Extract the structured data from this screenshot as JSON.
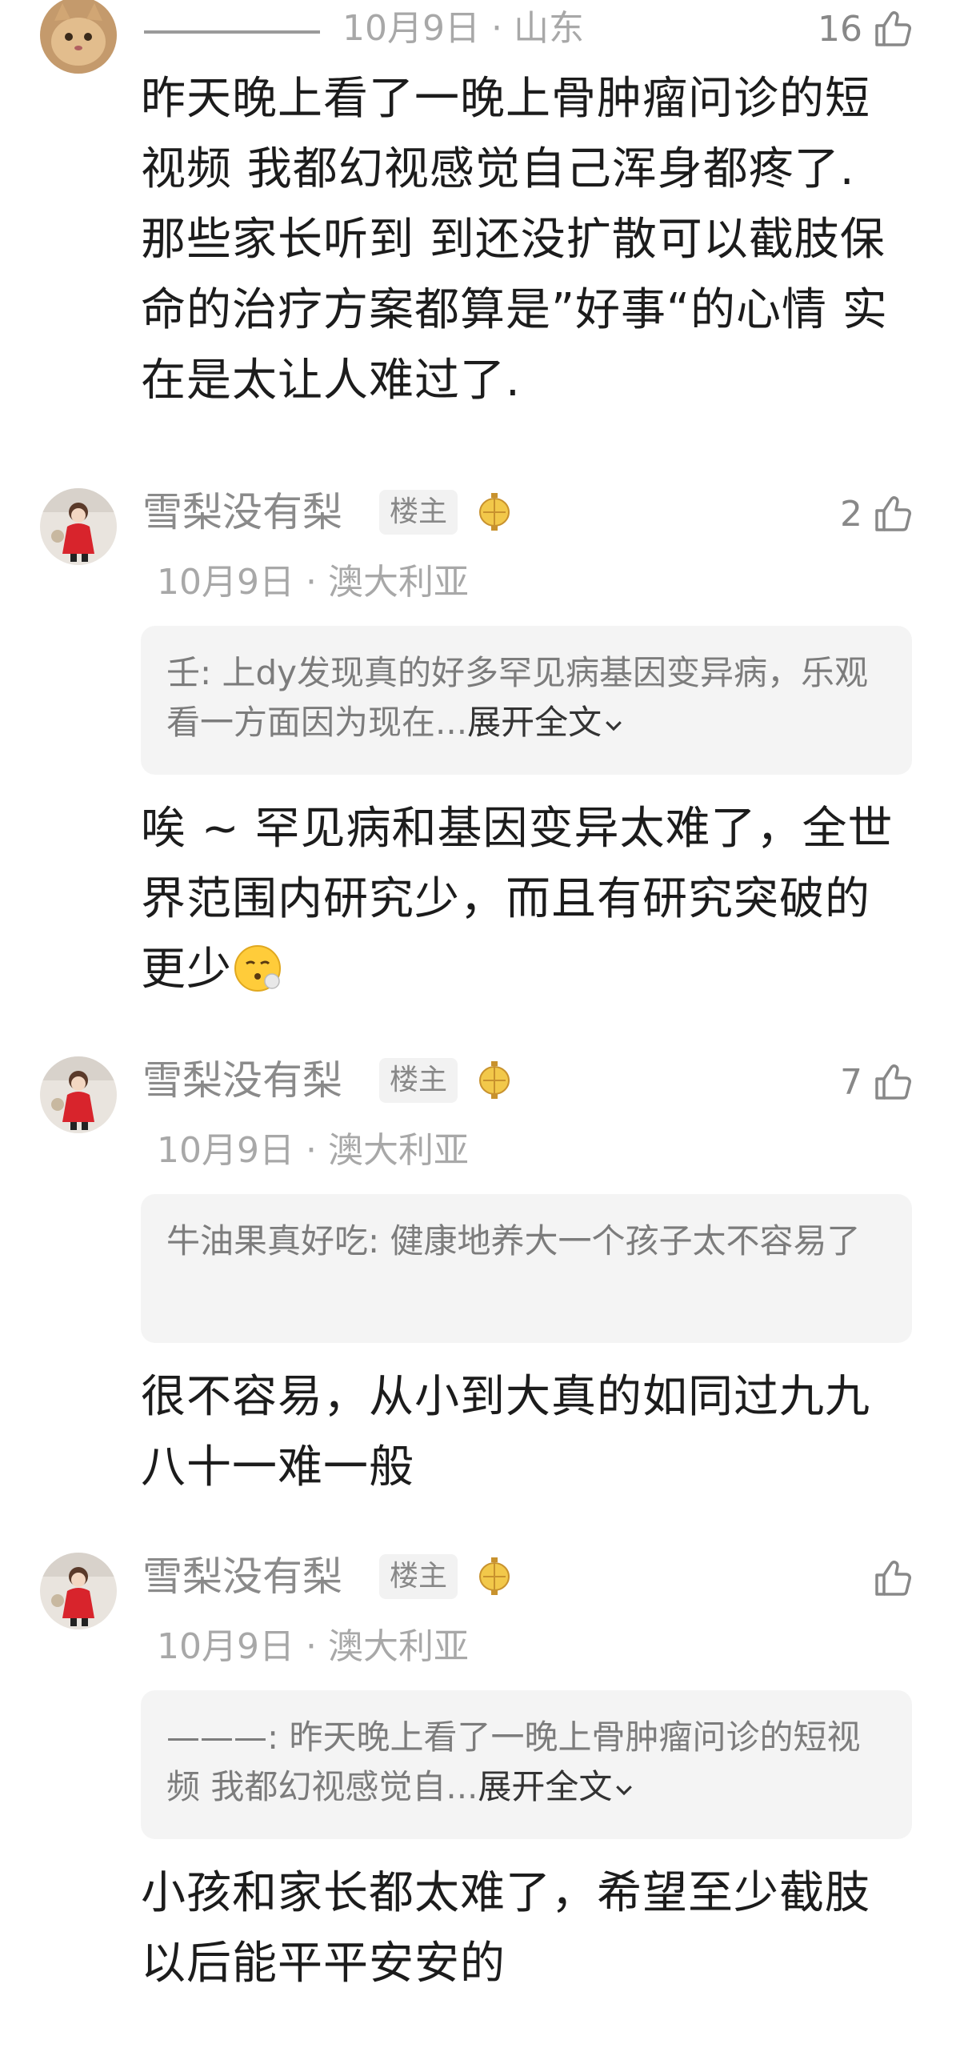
{
  "comments": [
    {
      "username": "———— ",
      "meta": "10月9日 · 山东",
      "likes": "16",
      "text": "昨天晚上看了一晚上骨肿瘤问诊的短视频 我都幻视感觉自己浑身都疼了. 那些家长听到 到还没扩散可以截肢保命的治疗方案都算是”好事“的心情 实在是太让人难过了."
    },
    {
      "username": "雪梨没有梨",
      "badge": "楼主",
      "meta": "10月9日 · 澳大利亚",
      "likes": "2",
      "quote": "壬: 上dy发现真的好多罕见病基因变异病，乐观看一方面因为现在...",
      "expand": "展开全文",
      "text": "唉 ~ 罕见病和基因变异太难了，全世界范围内研究少，而且有研究突破的更少"
    },
    {
      "username": "雪梨没有梨",
      "badge": "楼主",
      "meta": "10月9日 · 澳大利亚",
      "likes": "7",
      "quote": "牛油果真好吃: 健康地养大一个孩子太不容易了",
      "text": "很不容易，从小到大真的如同过九九八十一难一般"
    },
    {
      "username": "雪梨没有梨",
      "badge": "楼主",
      "meta": "10月9日 · 澳大利亚",
      "likes": "",
      "quote": "———: 昨天晚上看了一晚上骨肿瘤问诊的短视频 我都幻视感觉自...",
      "expand": "展开全文",
      "text": "小孩和家长都太难了，希望至少截肢以后能平平安安的"
    }
  ],
  "icons": {
    "like": "thumbs-up-icon",
    "expand": "chevron-down-icon",
    "lantern": "lantern-icon",
    "emoji": "exhale-face-emoji"
  },
  "colors": {
    "secondary_text": "#8a8a8a",
    "quote_bg": "#f4f4f4",
    "badge_bg": "#f2f2f2"
  }
}
